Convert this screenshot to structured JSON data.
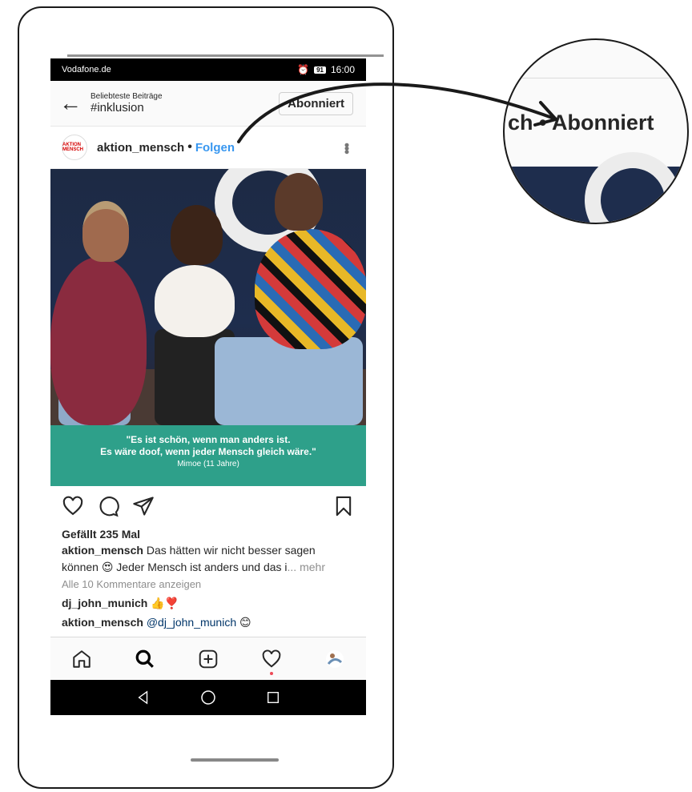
{
  "status": {
    "carrier": "Vodafone.de",
    "battery": "91",
    "time": "16:00"
  },
  "header": {
    "subtitle": "Beliebteste Beiträge",
    "hashtag": "#inklusion",
    "follow_button": "Abonniert"
  },
  "post": {
    "avatar_text": "AKTION MENSCH",
    "username": "aktion_mensch",
    "separator": "•",
    "follow_link": "Folgen",
    "quote_line1": "\"Es ist schön, wenn man anders ist.",
    "quote_line2": "Es wäre doof, wenn jeder Mensch gleich wäre.\"",
    "quote_author": "Mimoe (11 Jahre)",
    "likes": "Gefällt 235 Mal",
    "caption_user": "aktion_mensch",
    "caption_text": " Das hätten wir nicht besser sagen können 😍 Jeder Mensch ist anders und das i",
    "caption_more": "... mehr",
    "view_comments": "Alle 10 Kommentare anzeigen",
    "comment1_user": "dj_john_munich",
    "comment1_text": " 👍❣️",
    "comment2_user": "aktion_mensch",
    "comment2_mention": " @dj_john_munich",
    "comment2_emoji": " 😊"
  },
  "zoom": {
    "text": "ch • Abonniert"
  },
  "icons": {
    "action_bar": [
      "heart-icon",
      "comment-icon",
      "share-icon",
      "bookmark-icon"
    ],
    "tab_bar": [
      "home-icon",
      "search-icon",
      "add-post-icon",
      "activity-heart-icon",
      "profile-avatar-icon"
    ],
    "nav_bar": [
      "back-triangle-icon",
      "home-circle-icon",
      "recents-square-icon"
    ]
  },
  "colors": {
    "accent_blue": "#3897f0",
    "quote_green": "#2ea08a",
    "notification_dot": "#ed4956"
  }
}
